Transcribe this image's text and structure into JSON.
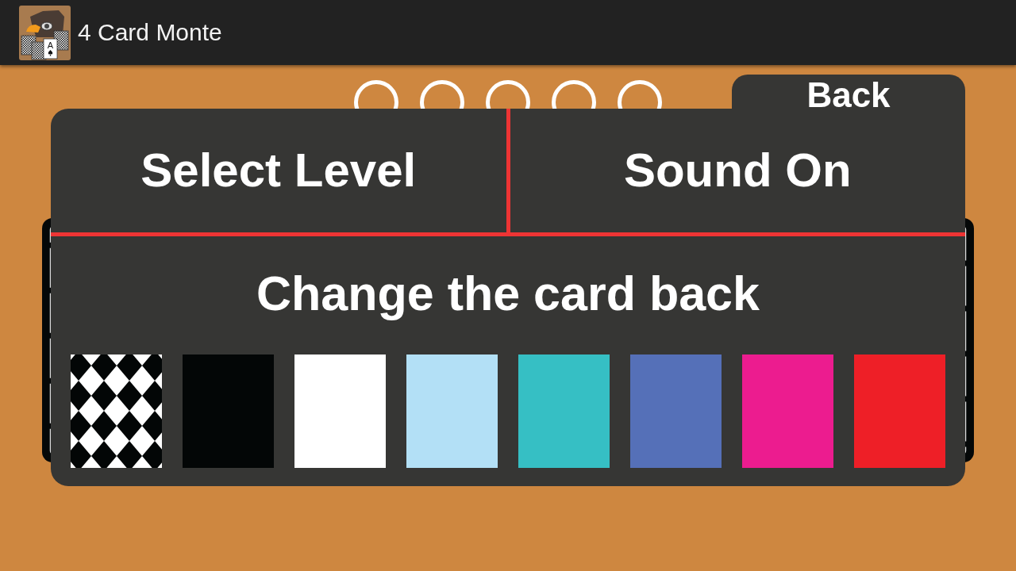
{
  "app_bar": {
    "icon_card_rank": "A",
    "title": "4 Card Monte"
  },
  "progress_rings": [
    {
      "completed": false
    },
    {
      "completed": false
    },
    {
      "completed": false
    },
    {
      "completed": false
    },
    {
      "completed": false
    }
  ],
  "back_button": {
    "label": "Back"
  },
  "settings": {
    "menu_items": [
      {
        "label": "Select Level"
      },
      {
        "label": "Sound On"
      }
    ],
    "card_back": {
      "heading": "Change the card back",
      "options": [
        {
          "kind": "pattern"
        },
        {
          "kind": "solid",
          "color": "#030606"
        },
        {
          "kind": "solid",
          "color": "#ffffff"
        },
        {
          "kind": "solid",
          "color": "#b3e0f6"
        },
        {
          "kind": "solid",
          "color": "#36bfc4"
        },
        {
          "kind": "solid",
          "color": "#5570b8"
        },
        {
          "kind": "solid",
          "color": "#ec1c8f"
        },
        {
          "kind": "solid",
          "color": "#ee1f27"
        }
      ]
    }
  }
}
